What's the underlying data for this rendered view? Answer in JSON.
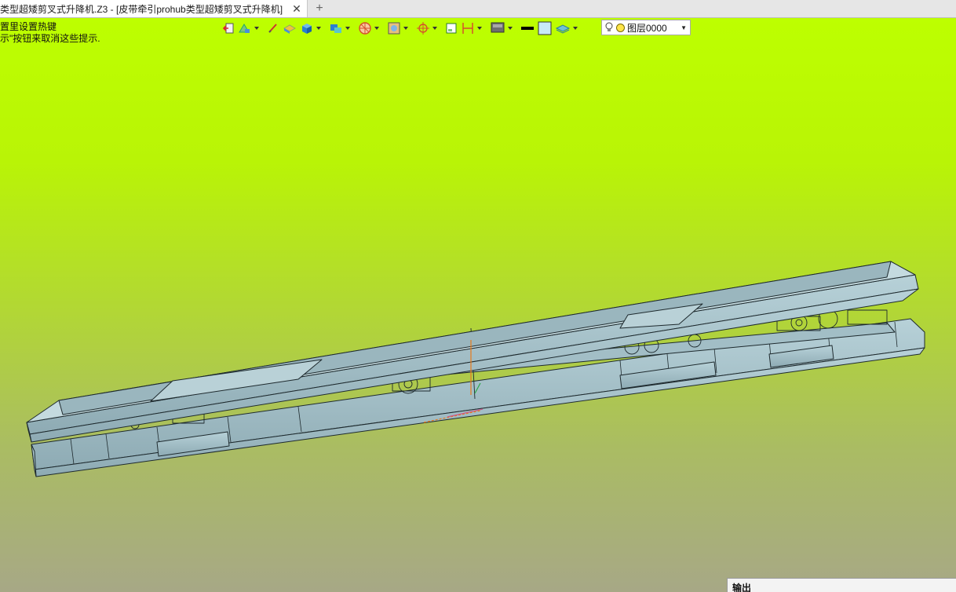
{
  "tab": {
    "title": "类型超矮剪叉式升降机.Z3 - [皮带牵引prohub类型超矮剪叉式升降机]",
    "close_glyph": "✕",
    "add_glyph": "+"
  },
  "hint": {
    "line1": "置里设置热键",
    "line2": "示\"按钮来取消这些提示."
  },
  "toolbar": {
    "icons": [
      "exit-icon",
      "align-icon",
      "paint-icon",
      "face-color-icon",
      "solid-icon",
      "material-icon",
      "render-icon",
      "view-cube-icon",
      "origin-icon",
      "frame-icon",
      "section-icon",
      "display-mode-icon",
      "line-color-icon",
      "fill-color-icon",
      "layer-stack-icon"
    ]
  },
  "layer": {
    "label": "图层0000",
    "dropdown_glyph": "▼"
  },
  "output": {
    "title": "输出"
  },
  "colors": {
    "viewport_top": "#bdff00",
    "viewport_bottom": "#a7a886",
    "model_fill": "#9fbcc4",
    "model_stroke": "#1e2a2e"
  }
}
